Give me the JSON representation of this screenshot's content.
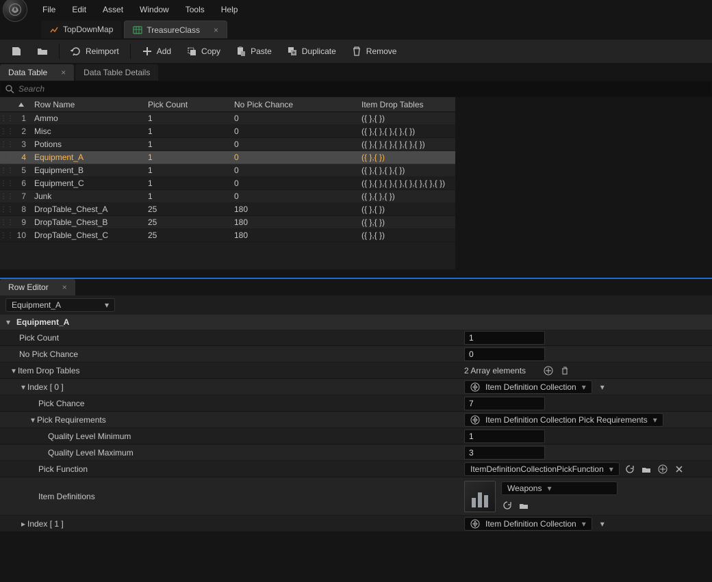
{
  "menu": {
    "items": [
      "File",
      "Edit",
      "Asset",
      "Window",
      "Tools",
      "Help"
    ]
  },
  "assetTabs": [
    {
      "label": "TopDownMap",
      "active": false
    },
    {
      "label": "TreasureClass",
      "active": true
    }
  ],
  "toolbar": {
    "reimport": "Reimport",
    "add": "Add",
    "copy": "Copy",
    "paste": "Paste",
    "duplicate": "Duplicate",
    "remove": "Remove"
  },
  "panelTabs": {
    "dataTable": "Data Table",
    "dataTableDetails": "Data Table Details"
  },
  "search": {
    "placeholder": "Search"
  },
  "table": {
    "headers": {
      "rowName": "Row Name",
      "pickCount": "Pick Count",
      "noPickChance": "No Pick Chance",
      "itemDrop": "Item Drop Tables"
    },
    "rows": [
      {
        "idx": "1",
        "name": "Ammo",
        "pick": "1",
        "nopick": "0",
        "drop": "({ },{ })"
      },
      {
        "idx": "2",
        "name": "Misc",
        "pick": "1",
        "nopick": "0",
        "drop": "({ },{ },{ },{ },{ })"
      },
      {
        "idx": "3",
        "name": "Potions",
        "pick": "1",
        "nopick": "0",
        "drop": "({ },{ },{ },{ },{ },{ })"
      },
      {
        "idx": "4",
        "name": "Equipment_A",
        "pick": "1",
        "nopick": "0",
        "drop": "({ },{ })",
        "selected": true
      },
      {
        "idx": "5",
        "name": "Equipment_B",
        "pick": "1",
        "nopick": "0",
        "drop": "({ },{ },{ },{ })"
      },
      {
        "idx": "6",
        "name": "Equipment_C",
        "pick": "1",
        "nopick": "0",
        "drop": "({ },{ },{ },{ },{ },{ },{ },{ })"
      },
      {
        "idx": "7",
        "name": "Junk",
        "pick": "1",
        "nopick": "0",
        "drop": "({ },{ },{ })"
      },
      {
        "idx": "8",
        "name": "DropTable_Chest_A",
        "pick": "25",
        "nopick": "180",
        "drop": "({ },{ })"
      },
      {
        "idx": "9",
        "name": "DropTable_Chest_B",
        "pick": "25",
        "nopick": "180",
        "drop": "({ },{ })"
      },
      {
        "idx": "10",
        "name": "DropTable_Chest_C",
        "pick": "25",
        "nopick": "180",
        "drop": "({ },{ })"
      }
    ]
  },
  "rowEditor": {
    "tab": "Row Editor",
    "selected": "Equipment_A",
    "sectionTitle": "Equipment_A",
    "pickCountLabel": "Pick Count",
    "pickCountValue": "1",
    "noPickChanceLabel": "No Pick Chance",
    "noPickChanceValue": "0",
    "itemDropLabel": "Item Drop Tables",
    "arrayInfo": "2 Array elements",
    "index0Label": "Index [ 0 ]",
    "index1Label": "Index [ 1 ]",
    "itemDefCollection": "Item Definition Collection",
    "pickChanceLabel": "Pick Chance",
    "pickChanceValue": "7",
    "pickReqLabel": "Pick Requirements",
    "pickReqValue": "Item Definition Collection Pick Requirements",
    "qMinLabel": "Quality Level Minimum",
    "qMinValue": "1",
    "qMaxLabel": "Quality Level Maximum",
    "qMaxValue": "3",
    "pickFuncLabel": "Pick Function",
    "pickFuncValue": "ItemDefinitionCollectionPickFunction",
    "itemDefsLabel": "Item Definitions",
    "itemDefsValue": "Weapons"
  }
}
